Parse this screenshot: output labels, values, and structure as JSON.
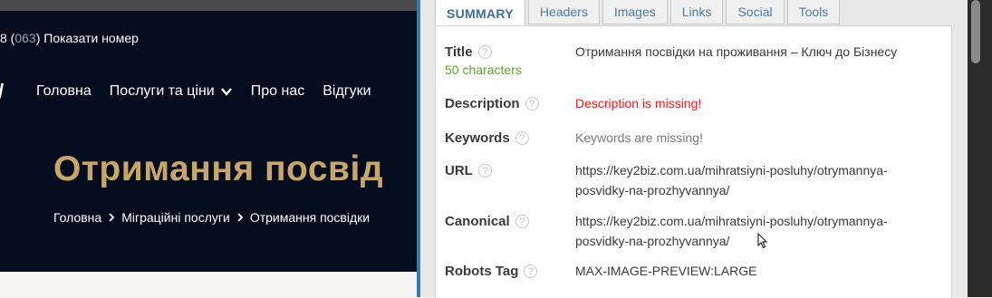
{
  "website": {
    "phone_prefix": "8 (",
    "phone_code": "063",
    "phone_suffix": ")",
    "phone_action": "Показати номер",
    "logo_fragment": "/",
    "nav": [
      "Головна",
      "Послуги та ціни",
      "Про нас",
      "Відгуки"
    ],
    "hero_title": "Отримання посвід",
    "breadcrumbs": [
      "Головна",
      "Міграційні послуги",
      "Отримання посвідки"
    ]
  },
  "seo_panel": {
    "tabs": [
      "SUMMARY",
      "Headers",
      "Images",
      "Links",
      "Social",
      "Tools"
    ],
    "active_tab": "SUMMARY",
    "help_glyph": "?",
    "rows": {
      "title": {
        "label": "Title",
        "sub": "50 characters",
        "value": "Отримання посвідки на проживання – Ключ до Бізнесу"
      },
      "description": {
        "label": "Description",
        "value": "Description is missing!"
      },
      "keywords": {
        "label": "Keywords",
        "value": "Keywords are missing!"
      },
      "url": {
        "label": "URL",
        "line1": "https://key2biz.com.ua/mihratsiyni-posluhy/otrymannya-",
        "line2": "posvidky-na-prozhyvannya/"
      },
      "canonical": {
        "label": "Canonical",
        "line1": "https://key2biz.com.ua/mihratsiyni-posluhy/otrymannya-",
        "line2": "posvidky-na-prozhyvannya/"
      },
      "robots": {
        "label": "Robots Tag",
        "value": "MAX-IMAGE-PREVIEW:LARGE"
      }
    }
  },
  "colors": {
    "site_bg": "#040d1e",
    "hero_gold": "#c8a56a",
    "panel_border": "#3b7aa8",
    "tab_blue": "#4a7ca8",
    "ok_green": "#5aa630",
    "error_red": "#e02020"
  }
}
